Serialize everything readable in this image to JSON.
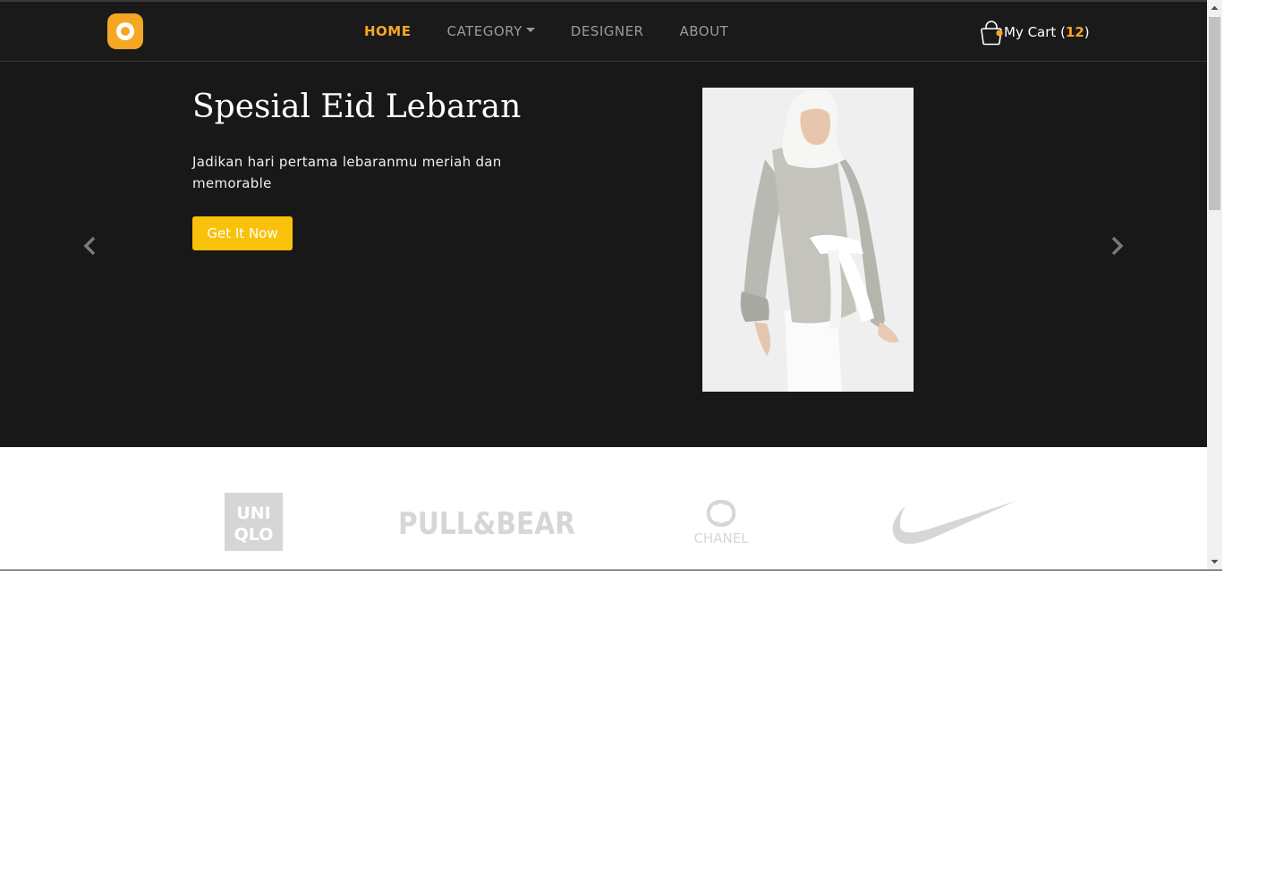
{
  "nav": {
    "items": [
      {
        "label": "HOME",
        "active": true
      },
      {
        "label": "CATEGORY",
        "active": false,
        "dropdown": true
      },
      {
        "label": "DESIGNER",
        "active": false
      },
      {
        "label": "ABOUT",
        "active": false
      }
    ],
    "cart": {
      "prefix": "My Cart (",
      "count": "12",
      "suffix": ")"
    }
  },
  "hero": {
    "title": "Spesial Eid Lebaran",
    "description": "Jadikan hari pertama lebaranmu meriah dan memorable",
    "button_label": "Get It Now"
  },
  "brands": {
    "items": [
      {
        "name": "UNIQLO",
        "lines": [
          "UNI",
          "QLO"
        ]
      },
      {
        "name": "PULL&BEAR",
        "text": "PULL&BEAR"
      },
      {
        "name": "CHANEL",
        "text": "CHANEL"
      },
      {
        "name": "Nike"
      }
    ]
  },
  "colors": {
    "accent": "#f5a623",
    "button": "#f9c20a",
    "navbar": "#1a1a1a",
    "hero": "#181818",
    "brand_logo": "#d6d6d6"
  },
  "icons": {
    "logo": "logo-ring-icon",
    "cart": "shopping-bag-icon",
    "prev": "chevron-left-icon",
    "next": "chevron-right-icon"
  }
}
